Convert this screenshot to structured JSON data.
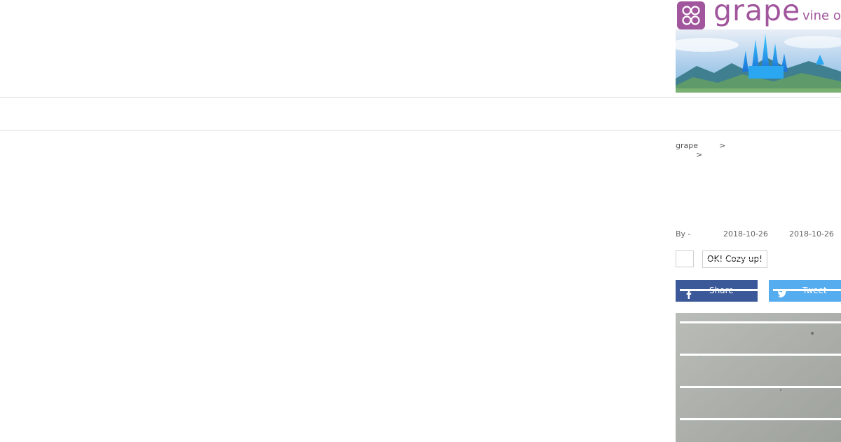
{
  "logo": {
    "wordmark": "grape",
    "tagline": "vine of"
  },
  "breadcrumb": {
    "home": "grape",
    "sep1": ">",
    "sep2": ">"
  },
  "meta": {
    "author": "By -",
    "published": "2018-10-26",
    "updated": "2018-10-26"
  },
  "reaction": {
    "button_label": "OK! Cozy up!"
  },
  "share": {
    "facebook_label": "Share",
    "twitter_label": "Tweet"
  },
  "colors": {
    "brand": "#a0559c",
    "facebook": "#3b5998",
    "twitter": "#55acee"
  }
}
